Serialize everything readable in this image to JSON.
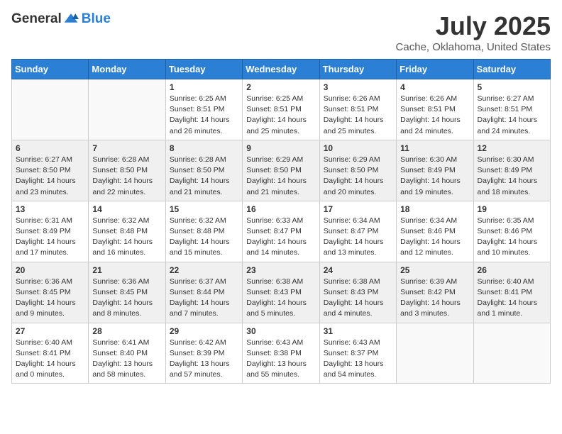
{
  "logo": {
    "general": "General",
    "blue": "Blue"
  },
  "title": "July 2025",
  "subtitle": "Cache, Oklahoma, United States",
  "days_of_week": [
    "Sunday",
    "Monday",
    "Tuesday",
    "Wednesday",
    "Thursday",
    "Friday",
    "Saturday"
  ],
  "weeks": [
    [
      {
        "day": "",
        "empty": true
      },
      {
        "day": "",
        "empty": true
      },
      {
        "day": "1",
        "sunrise": "Sunrise: 6:25 AM",
        "sunset": "Sunset: 8:51 PM",
        "daylight": "Daylight: 14 hours and 26 minutes."
      },
      {
        "day": "2",
        "sunrise": "Sunrise: 6:25 AM",
        "sunset": "Sunset: 8:51 PM",
        "daylight": "Daylight: 14 hours and 25 minutes."
      },
      {
        "day": "3",
        "sunrise": "Sunrise: 6:26 AM",
        "sunset": "Sunset: 8:51 PM",
        "daylight": "Daylight: 14 hours and 25 minutes."
      },
      {
        "day": "4",
        "sunrise": "Sunrise: 6:26 AM",
        "sunset": "Sunset: 8:51 PM",
        "daylight": "Daylight: 14 hours and 24 minutes."
      },
      {
        "day": "5",
        "sunrise": "Sunrise: 6:27 AM",
        "sunset": "Sunset: 8:51 PM",
        "daylight": "Daylight: 14 hours and 24 minutes."
      }
    ],
    [
      {
        "day": "6",
        "sunrise": "Sunrise: 6:27 AM",
        "sunset": "Sunset: 8:50 PM",
        "daylight": "Daylight: 14 hours and 23 minutes."
      },
      {
        "day": "7",
        "sunrise": "Sunrise: 6:28 AM",
        "sunset": "Sunset: 8:50 PM",
        "daylight": "Daylight: 14 hours and 22 minutes."
      },
      {
        "day": "8",
        "sunrise": "Sunrise: 6:28 AM",
        "sunset": "Sunset: 8:50 PM",
        "daylight": "Daylight: 14 hours and 21 minutes."
      },
      {
        "day": "9",
        "sunrise": "Sunrise: 6:29 AM",
        "sunset": "Sunset: 8:50 PM",
        "daylight": "Daylight: 14 hours and 21 minutes."
      },
      {
        "day": "10",
        "sunrise": "Sunrise: 6:29 AM",
        "sunset": "Sunset: 8:50 PM",
        "daylight": "Daylight: 14 hours and 20 minutes."
      },
      {
        "day": "11",
        "sunrise": "Sunrise: 6:30 AM",
        "sunset": "Sunset: 8:49 PM",
        "daylight": "Daylight: 14 hours and 19 minutes."
      },
      {
        "day": "12",
        "sunrise": "Sunrise: 6:30 AM",
        "sunset": "Sunset: 8:49 PM",
        "daylight": "Daylight: 14 hours and 18 minutes."
      }
    ],
    [
      {
        "day": "13",
        "sunrise": "Sunrise: 6:31 AM",
        "sunset": "Sunset: 8:49 PM",
        "daylight": "Daylight: 14 hours and 17 minutes."
      },
      {
        "day": "14",
        "sunrise": "Sunrise: 6:32 AM",
        "sunset": "Sunset: 8:48 PM",
        "daylight": "Daylight: 14 hours and 16 minutes."
      },
      {
        "day": "15",
        "sunrise": "Sunrise: 6:32 AM",
        "sunset": "Sunset: 8:48 PM",
        "daylight": "Daylight: 14 hours and 15 minutes."
      },
      {
        "day": "16",
        "sunrise": "Sunrise: 6:33 AM",
        "sunset": "Sunset: 8:47 PM",
        "daylight": "Daylight: 14 hours and 14 minutes."
      },
      {
        "day": "17",
        "sunrise": "Sunrise: 6:34 AM",
        "sunset": "Sunset: 8:47 PM",
        "daylight": "Daylight: 14 hours and 13 minutes."
      },
      {
        "day": "18",
        "sunrise": "Sunrise: 6:34 AM",
        "sunset": "Sunset: 8:46 PM",
        "daylight": "Daylight: 14 hours and 12 minutes."
      },
      {
        "day": "19",
        "sunrise": "Sunrise: 6:35 AM",
        "sunset": "Sunset: 8:46 PM",
        "daylight": "Daylight: 14 hours and 10 minutes."
      }
    ],
    [
      {
        "day": "20",
        "sunrise": "Sunrise: 6:36 AM",
        "sunset": "Sunset: 8:45 PM",
        "daylight": "Daylight: 14 hours and 9 minutes."
      },
      {
        "day": "21",
        "sunrise": "Sunrise: 6:36 AM",
        "sunset": "Sunset: 8:45 PM",
        "daylight": "Daylight: 14 hours and 8 minutes."
      },
      {
        "day": "22",
        "sunrise": "Sunrise: 6:37 AM",
        "sunset": "Sunset: 8:44 PM",
        "daylight": "Daylight: 14 hours and 7 minutes."
      },
      {
        "day": "23",
        "sunrise": "Sunrise: 6:38 AM",
        "sunset": "Sunset: 8:43 PM",
        "daylight": "Daylight: 14 hours and 5 minutes."
      },
      {
        "day": "24",
        "sunrise": "Sunrise: 6:38 AM",
        "sunset": "Sunset: 8:43 PM",
        "daylight": "Daylight: 14 hours and 4 minutes."
      },
      {
        "day": "25",
        "sunrise": "Sunrise: 6:39 AM",
        "sunset": "Sunset: 8:42 PM",
        "daylight": "Daylight: 14 hours and 3 minutes."
      },
      {
        "day": "26",
        "sunrise": "Sunrise: 6:40 AM",
        "sunset": "Sunset: 8:41 PM",
        "daylight": "Daylight: 14 hours and 1 minute."
      }
    ],
    [
      {
        "day": "27",
        "sunrise": "Sunrise: 6:40 AM",
        "sunset": "Sunset: 8:41 PM",
        "daylight": "Daylight: 14 hours and 0 minutes."
      },
      {
        "day": "28",
        "sunrise": "Sunrise: 6:41 AM",
        "sunset": "Sunset: 8:40 PM",
        "daylight": "Daylight: 13 hours and 58 minutes."
      },
      {
        "day": "29",
        "sunrise": "Sunrise: 6:42 AM",
        "sunset": "Sunset: 8:39 PM",
        "daylight": "Daylight: 13 hours and 57 minutes."
      },
      {
        "day": "30",
        "sunrise": "Sunrise: 6:43 AM",
        "sunset": "Sunset: 8:38 PM",
        "daylight": "Daylight: 13 hours and 55 minutes."
      },
      {
        "day": "31",
        "sunrise": "Sunrise: 6:43 AM",
        "sunset": "Sunset: 8:37 PM",
        "daylight": "Daylight: 13 hours and 54 minutes."
      },
      {
        "day": "",
        "empty": true
      },
      {
        "day": "",
        "empty": true
      }
    ]
  ]
}
